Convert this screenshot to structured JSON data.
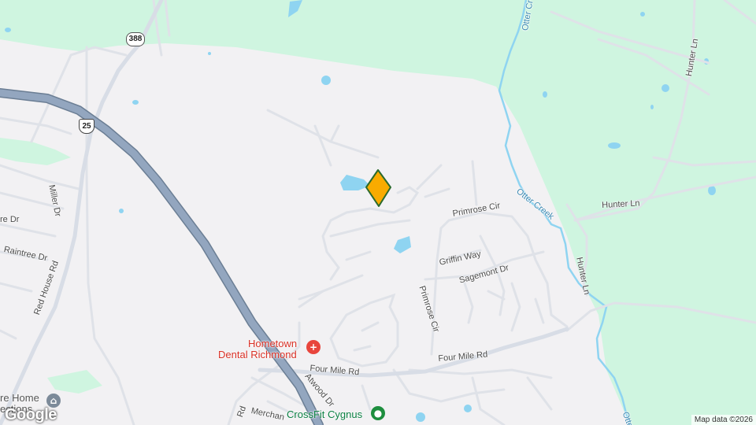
{
  "map": {
    "colors": {
      "land": "#f2f1f3",
      "park": "#cff5e0",
      "water": "#8fd4f1",
      "highway": "#8ca0b8",
      "road": "#d8dde6",
      "marker": "#f9ab00"
    },
    "shields": {
      "route_388": "388",
      "us_25": "25"
    },
    "streets": {
      "miller_dr": "Miller Dr",
      "raintree_dr": "Raintree Dr",
      "tre_dr": "re Dr",
      "red_house_rd": "Red House Rd",
      "primrose_cir_top": "Primrose Cir",
      "primrose_cir_vertical": "Primrose Cir",
      "griffin_way": "Griffin Way",
      "sagemont_dr": "Sagemont Dr",
      "four_mile_rd_left": "Four Mile Rd",
      "four_mile_rd_right": "Four Mile Rd",
      "atwood_dr": "Atwood Dr",
      "merchant": "Merchan",
      "rd_fragment": "Rd",
      "hunter_ln_top": "Hunter Ln",
      "hunter_ln_mid": "Hunter Ln",
      "hunter_ln_vertical": "Hunter Ln",
      "otter_creek_top": "Otter Cr",
      "otter_creek_mid": "Otter Creek",
      "otter_creek_bottom": "Otter"
    },
    "pois": {
      "dental_line1": "Hometown",
      "dental_line2": "Dental Richmond",
      "crossfit": "CrossFit Cygnus",
      "home_line1": "re Home",
      "home_line2": "ections"
    },
    "icons": {
      "dental": "medical-cross-icon",
      "crossfit": "fitness-icon",
      "home": "landmark-icon",
      "marker": "location-marker-icon"
    },
    "logo": "Google",
    "attribution": "Map data ©2026"
  }
}
